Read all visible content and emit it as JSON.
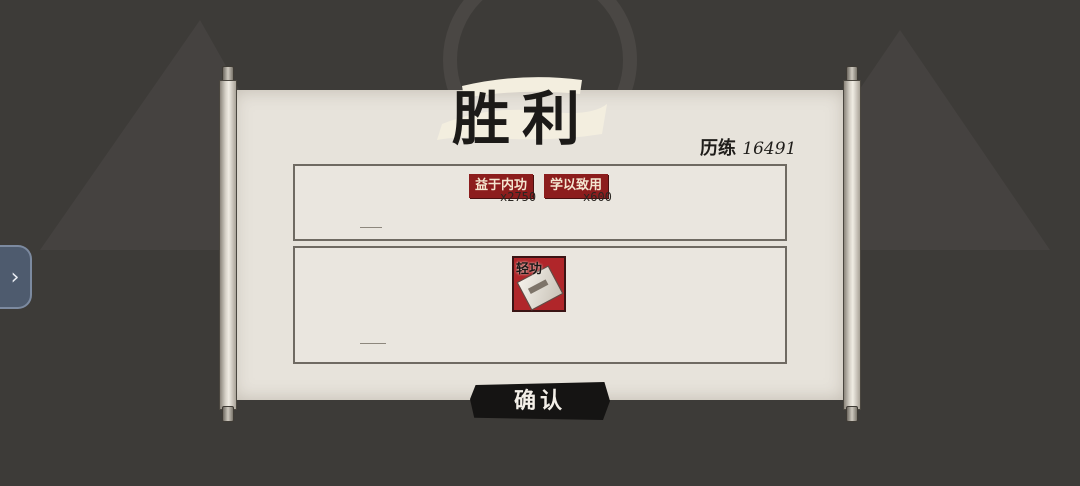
{
  "title": "胜利",
  "experience": {
    "label": "历练",
    "value": "16491"
  },
  "rewards": [
    {
      "label": "益于内功",
      "count": "x2750"
    },
    {
      "label": "学以致用",
      "count": "x600"
    }
  ],
  "item": {
    "label": "轻功",
    "icon": "scroll-icon"
  },
  "confirm_label": "确认",
  "side_tab_icon": "chevron-right-icon",
  "colors": {
    "accent_red": "#8c1d1d",
    "paper": "#e7e3db",
    "background": "#3d3b38"
  }
}
